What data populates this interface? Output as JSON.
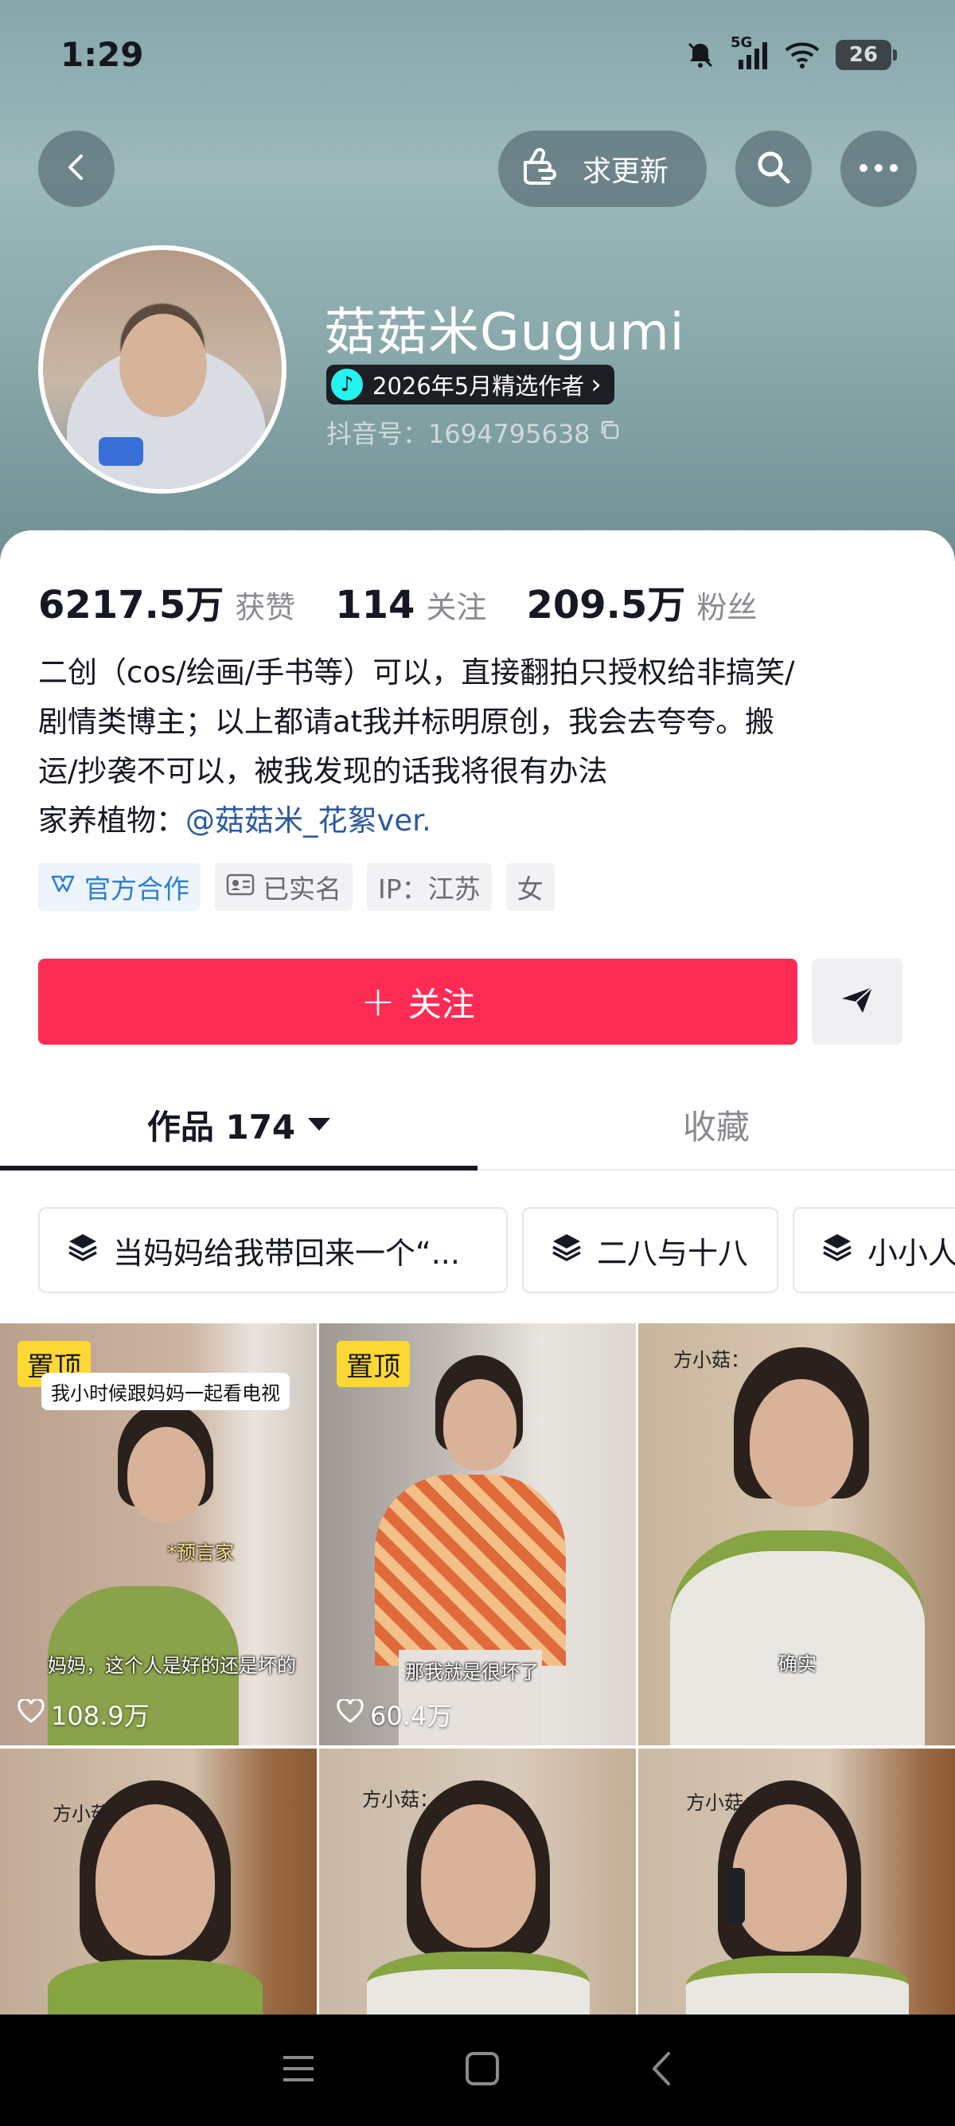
{
  "status_bar": {
    "time": "1:29",
    "network_label": "5G",
    "battery_level": "26"
  },
  "header": {
    "update_button_label": "求更新",
    "profile_name": "菇菇米Gugumi",
    "badge_text": "2026年5月精选作者",
    "badge_chevron": "›",
    "douyin_id": "抖音号：1694795638"
  },
  "stats": [
    {
      "value": "6217.5万",
      "label": "获赞"
    },
    {
      "value": "114",
      "label": "关注"
    },
    {
      "value": "209.5万",
      "label": "粉丝"
    }
  ],
  "bio": {
    "line1": "二创（cos/绘画/手书等）可以，直接翻拍只授权给非搞笑/",
    "line2": "剧情类博主；以上都请at我并标明原创，我会去夸夸。搬",
    "line3": "运/抄袭不可以，被我发现的话我将很有办法",
    "line4_prefix": "家养植物：",
    "line4_link": "@菇菇米_花絮ver."
  },
  "tags": [
    {
      "label": "官方合作",
      "icon": "official-cooperation-icon"
    },
    {
      "label": "已实名",
      "icon": "id-card-icon"
    },
    {
      "label": "IP：江苏"
    },
    {
      "label": "女"
    }
  ],
  "actions": {
    "follow_label": "关注",
    "follow_plus": "+"
  },
  "tabs": [
    {
      "label": "作品 174",
      "active": true
    },
    {
      "label": "收藏",
      "active": false
    }
  ],
  "collections": [
    {
      "label": "当妈妈给我带回来一个“..."
    },
    {
      "label": "二八与十八"
    },
    {
      "label": "小小人"
    }
  ],
  "videos": [
    {
      "pinned_label": "置顶",
      "likes": "108.9万",
      "caption_top": "我小时候跟妈妈一起看电视",
      "caption_mid": "*预言家",
      "caption_bottom": "妈妈，这个人是好的还是坏的"
    },
    {
      "pinned_label": "置顶",
      "likes": "60.4万",
      "caption_bottom": "那我就是很坏了"
    },
    {
      "caption_top": "方小菇：",
      "caption_mid": "确实"
    },
    {
      "caption_top": "方小菇："
    },
    {
      "caption_top": "方小菇："
    },
    {
      "caption_top": "方小菇："
    }
  ],
  "colors": {
    "accent": "#fe2c55",
    "header_teal": "#8aa9ab",
    "pin_yellow": "#fdd835",
    "link_blue": "#2c5aa0"
  }
}
